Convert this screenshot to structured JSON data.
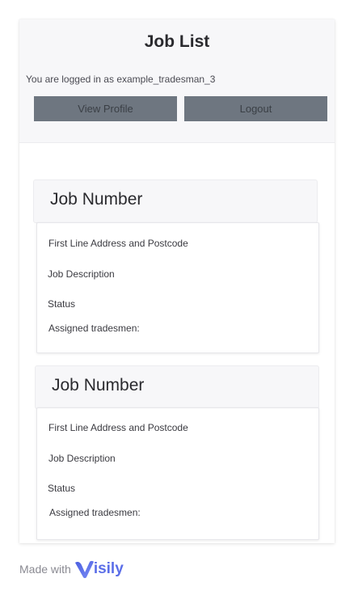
{
  "header": {
    "title": "Job List",
    "login_status": "You are logged in as example_tradesman_3",
    "view_profile_label": "View Profile",
    "logout_label": "Logout"
  },
  "jobs": [
    {
      "number_label": "Job Number",
      "address_label": "First Line Address and Postcode",
      "description_label": "Job Description",
      "status_label": "Status",
      "assigned_label": "Assigned tradesmen:"
    },
    {
      "number_label": "Job Number",
      "address_label": "First Line Address and Postcode",
      "description_label": "Job Description",
      "status_label": "Status",
      "assigned_label": "Assigned tradesmen:"
    }
  ],
  "footer": {
    "made_with": "Made with",
    "brand_rest": "isily",
    "brand_color": "#5b6ee8"
  },
  "colors": {
    "button_bg": "#6e7680",
    "header_bg": "#f7f7f9"
  }
}
